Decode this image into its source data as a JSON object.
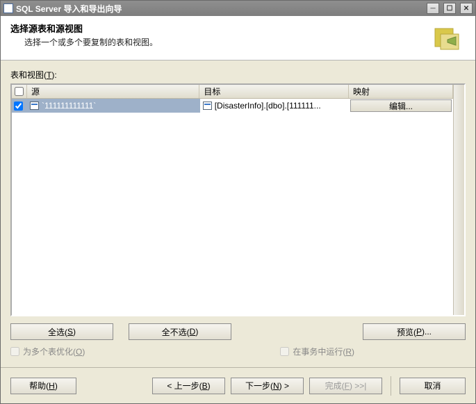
{
  "window": {
    "title": "SQL Server 导入和导出向导"
  },
  "header": {
    "title": "选择源表和源视图",
    "subtitle": "选择一个或多个要复制的表和视图。"
  },
  "list_label_prefix": "表和视图(",
  "list_label_accel": "T",
  "list_label_suffix": "):",
  "columns": {
    "source": "源",
    "target": "目标",
    "mapping": "映射"
  },
  "rows": [
    {
      "checked": true,
      "source": "`111111111111`",
      "target": "[DisasterInfo].[dbo].[111111...",
      "edit_label": "编辑..."
    }
  ],
  "buttons": {
    "select_all_prefix": "全选(",
    "select_all_accel": "S",
    "select_all_suffix": ")",
    "deselect_all_prefix": "全不选(",
    "deselect_all_accel": "D",
    "deselect_all_suffix": ")",
    "preview_prefix": "预览(",
    "preview_accel": "P",
    "preview_suffix": ")..."
  },
  "checks": {
    "optimize_prefix": "为多个表优化(",
    "optimize_accel": "O",
    "optimize_suffix": ")",
    "run_tx_prefix": "在事务中运行(",
    "run_tx_accel": "R",
    "run_tx_suffix": ")"
  },
  "footer": {
    "help_prefix": "帮助(",
    "help_accel": "H",
    "help_suffix": ")",
    "back_prefix": "< 上一步(",
    "back_accel": "B",
    "back_suffix": ")",
    "next_prefix": "下一步(",
    "next_accel": "N",
    "next_suffix": ") >",
    "finish_prefix": "完成(",
    "finish_accel": "F",
    "finish_suffix": ") >>|",
    "cancel": "取消"
  }
}
